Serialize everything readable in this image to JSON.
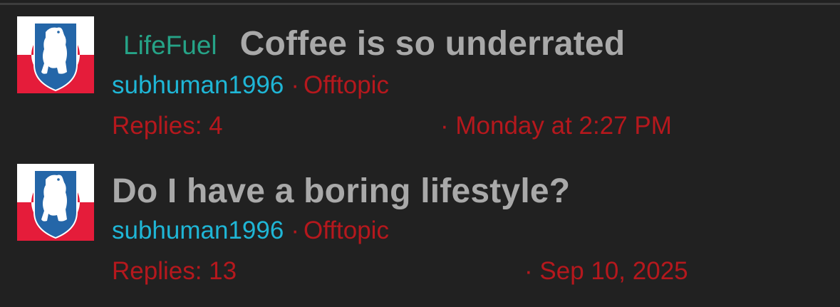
{
  "colors": {
    "background": "#212121",
    "prefix": "#26a387",
    "title": "#a9a9a9",
    "author": "#1fb6d6",
    "meta": "#b5181d"
  },
  "threads": [
    {
      "avatar_icon": "greenland-flag-polar-bear-avatar-icon",
      "prefix": "LifeFuel",
      "title": "Coffee is so underrated",
      "author": "subhuman1996",
      "separator": "·",
      "forum": "Offtopic",
      "replies": "Replies: 4",
      "date": "· Monday at 2:27 PM"
    },
    {
      "avatar_icon": "greenland-flag-polar-bear-avatar-icon",
      "prefix": "",
      "title": "Do I have a boring lifestyle?",
      "author": "subhuman1996",
      "separator": "·",
      "forum": "Offtopic",
      "replies": "Replies: 13",
      "date": "· Sep 10, 2025"
    }
  ]
}
